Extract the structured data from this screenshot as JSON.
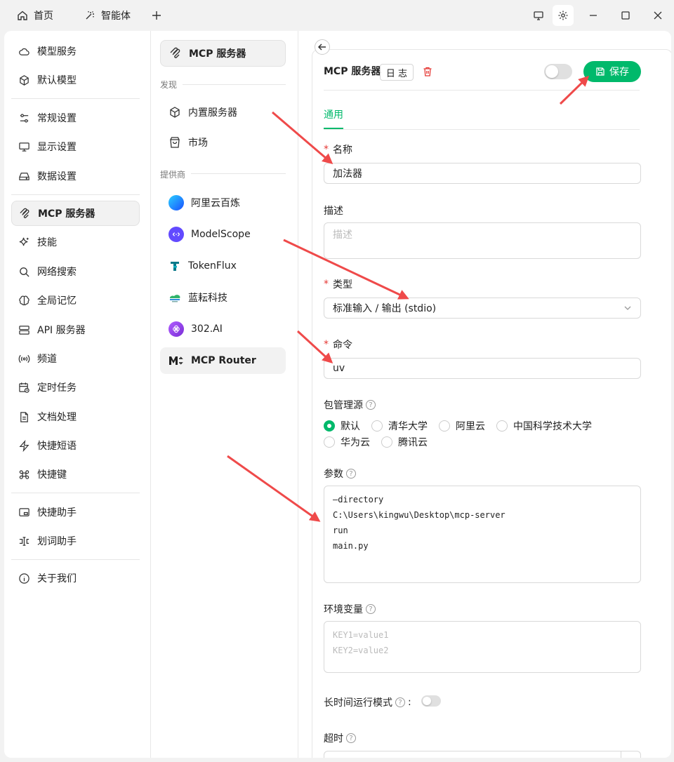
{
  "tabs": [
    {
      "label": "首页"
    },
    {
      "label": "智能体"
    }
  ],
  "sidebar": {
    "items": [
      {
        "label": "模型服务"
      },
      {
        "label": "默认模型"
      },
      {
        "label": "常规设置"
      },
      {
        "label": "显示设置"
      },
      {
        "label": "数据设置"
      },
      {
        "label": "MCP 服务器"
      },
      {
        "label": "技能"
      },
      {
        "label": "网络搜索"
      },
      {
        "label": "全局记忆"
      },
      {
        "label": "API 服务器"
      },
      {
        "label": "频道"
      },
      {
        "label": "定时任务"
      },
      {
        "label": "文档处理"
      },
      {
        "label": "快捷短语"
      },
      {
        "label": "快捷键"
      },
      {
        "label": "快捷助手"
      },
      {
        "label": "划词助手"
      },
      {
        "label": "关于我们"
      }
    ]
  },
  "mcp_nav": {
    "header": "MCP 服务器",
    "discover_label": "发现",
    "builtin": "内置服务器",
    "market": "市场",
    "providers_label": "提供商",
    "providers": [
      {
        "name": "阿里云百炼",
        "color": "#1a6cff"
      },
      {
        "name": "ModelScope",
        "color": "#624aff"
      },
      {
        "name": "TokenFlux",
        "color": "#0b7a8a"
      },
      {
        "name": "蓝耘科技",
        "color": "#2f8fd8"
      },
      {
        "name": "302.AI",
        "color": "#8e3fe0"
      },
      {
        "name": "MCP Router",
        "color": "#222222"
      }
    ]
  },
  "detail": {
    "title": "MCP 服务器",
    "log_label": "日 志",
    "save_label": "保存",
    "tab_general": "通用",
    "name_label": "名称",
    "name_value": "加法器",
    "desc_label": "描述",
    "desc_placeholder": "描述",
    "type_label": "类型",
    "type_value": "标准输入 / 输出 (stdio)",
    "command_label": "命令",
    "command_value": "uv",
    "registry_label": "包管理源",
    "registry_options": [
      "默认",
      "清华大学",
      "阿里云",
      "中国科学技术大学",
      "华为云",
      "腾讯云"
    ],
    "registry_selected": "默认",
    "args_label": "参数",
    "args_lines": [
      "—directory",
      "C:\\Users\\kingwu\\Desktop\\mcp-server",
      "run",
      "main.py"
    ],
    "env_label": "环境变量",
    "env_placeholder_lines": [
      "KEY1=value1",
      "KEY2=value2"
    ],
    "long_running_label": "长时间运行模式",
    "long_running_colon": ":",
    "timeout_label": "超时",
    "help_glyph": "?",
    "required_mark": "*",
    "enabled": false,
    "long_running": false
  },
  "colors": {
    "accent": "#00b96b",
    "danger": "#e53935",
    "annotation_arrow": "#ef4a4a"
  }
}
